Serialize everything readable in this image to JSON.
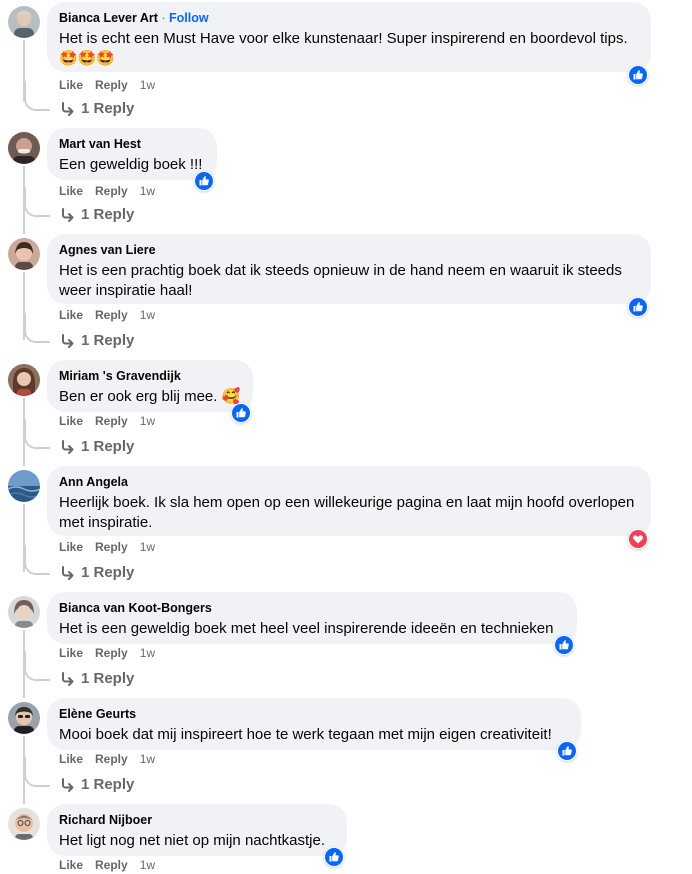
{
  "comments": [
    {
      "author": "Bianca Lever Art",
      "follow_label": "Follow",
      "separator": "·",
      "text": "Het is echt een Must Have voor elke kunstenaar! Super inspirerend en boordevol tips. 🤩🤩🤩",
      "like": "Like",
      "reply": "Reply",
      "time": "1w",
      "reaction": "like",
      "replies": "1 Reply"
    },
    {
      "author": "Mart van Hest",
      "text": "Een geweldig boek !!!",
      "like": "Like",
      "reply": "Reply",
      "time": "1w",
      "reaction": "like",
      "replies": "1 Reply"
    },
    {
      "author": "Agnes van Liere",
      "text": "Het is een prachtig boek dat ik steeds opnieuw in de hand neem en waaruit ik steeds weer inspiratie haal!",
      "like": "Like",
      "reply": "Reply",
      "time": "1w",
      "reaction": "like",
      "replies": "1 Reply"
    },
    {
      "author": "Miriam 's Gravendijk",
      "text": "Ben er ook erg blij mee. 🥰",
      "like": "Like",
      "reply": "Reply",
      "time": "1w",
      "reaction": "like",
      "replies": "1 Reply"
    },
    {
      "author": "Ann Angela",
      "text": "Heerlijk boek. Ik sla hem open op een willekeurige pagina en laat mijn hoofd overlopen met inspiratie.",
      "like": "Like",
      "reply": "Reply",
      "time": "1w",
      "reaction": "love",
      "replies": "1 Reply"
    },
    {
      "author": "Bianca van Koot-Bongers",
      "text": "Het is een geweldig boek met heel veel inspirerende ideeën en technieken",
      "like": "Like",
      "reply": "Reply",
      "time": "1w",
      "reaction": "like",
      "replies": "1 Reply"
    },
    {
      "author": "Elène Geurts",
      "text": "Mooi boek dat mij inspireert hoe te werk tegaan met mijn eigen creativiteit!",
      "like": "Like",
      "reply": "Reply",
      "time": "1w",
      "reaction": "like",
      "replies": "1 Reply"
    },
    {
      "author": "Richard Nijboer",
      "text": "Het ligt nog net niet op mijn nachtkastje.",
      "like": "Like",
      "reply": "Reply",
      "time": "1w",
      "reaction": "like"
    }
  ],
  "colors": {
    "like_blue": "#0866ff",
    "love_red": "#f33e58",
    "bubble": "#f0f2f5",
    "meta_gray": "#65676b"
  },
  "icons": {
    "like": "thumbs-up-icon",
    "love": "heart-icon",
    "replies": "reply-arrow-icon"
  }
}
